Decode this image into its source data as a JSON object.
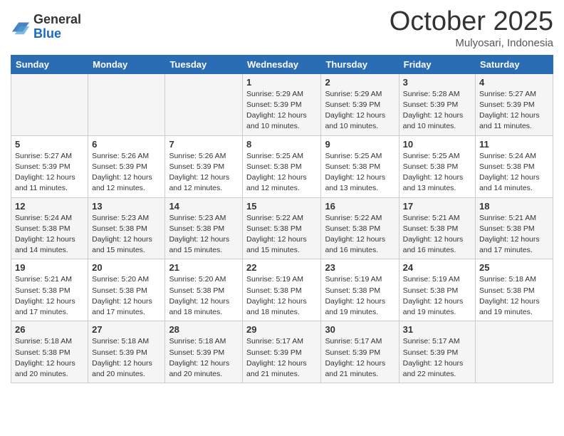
{
  "header": {
    "logo_general": "General",
    "logo_blue": "Blue",
    "month_title": "October 2025",
    "subtitle": "Mulyosari, Indonesia"
  },
  "weekdays": [
    "Sunday",
    "Monday",
    "Tuesday",
    "Wednesday",
    "Thursday",
    "Friday",
    "Saturday"
  ],
  "weeks": [
    [
      {
        "day": "",
        "sunrise": "",
        "sunset": "",
        "daylight": ""
      },
      {
        "day": "",
        "sunrise": "",
        "sunset": "",
        "daylight": ""
      },
      {
        "day": "",
        "sunrise": "",
        "sunset": "",
        "daylight": ""
      },
      {
        "day": "1",
        "sunrise": "Sunrise: 5:29 AM",
        "sunset": "Sunset: 5:39 PM",
        "daylight": "Daylight: 12 hours and 10 minutes."
      },
      {
        "day": "2",
        "sunrise": "Sunrise: 5:29 AM",
        "sunset": "Sunset: 5:39 PM",
        "daylight": "Daylight: 12 hours and 10 minutes."
      },
      {
        "day": "3",
        "sunrise": "Sunrise: 5:28 AM",
        "sunset": "Sunset: 5:39 PM",
        "daylight": "Daylight: 12 hours and 10 minutes."
      },
      {
        "day": "4",
        "sunrise": "Sunrise: 5:27 AM",
        "sunset": "Sunset: 5:39 PM",
        "daylight": "Daylight: 12 hours and 11 minutes."
      }
    ],
    [
      {
        "day": "5",
        "sunrise": "Sunrise: 5:27 AM",
        "sunset": "Sunset: 5:39 PM",
        "daylight": "Daylight: 12 hours and 11 minutes."
      },
      {
        "day": "6",
        "sunrise": "Sunrise: 5:26 AM",
        "sunset": "Sunset: 5:39 PM",
        "daylight": "Daylight: 12 hours and 12 minutes."
      },
      {
        "day": "7",
        "sunrise": "Sunrise: 5:26 AM",
        "sunset": "Sunset: 5:39 PM",
        "daylight": "Daylight: 12 hours and 12 minutes."
      },
      {
        "day": "8",
        "sunrise": "Sunrise: 5:25 AM",
        "sunset": "Sunset: 5:38 PM",
        "daylight": "Daylight: 12 hours and 12 minutes."
      },
      {
        "day": "9",
        "sunrise": "Sunrise: 5:25 AM",
        "sunset": "Sunset: 5:38 PM",
        "daylight": "Daylight: 12 hours and 13 minutes."
      },
      {
        "day": "10",
        "sunrise": "Sunrise: 5:25 AM",
        "sunset": "Sunset: 5:38 PM",
        "daylight": "Daylight: 12 hours and 13 minutes."
      },
      {
        "day": "11",
        "sunrise": "Sunrise: 5:24 AM",
        "sunset": "Sunset: 5:38 PM",
        "daylight": "Daylight: 12 hours and 14 minutes."
      }
    ],
    [
      {
        "day": "12",
        "sunrise": "Sunrise: 5:24 AM",
        "sunset": "Sunset: 5:38 PM",
        "daylight": "Daylight: 12 hours and 14 minutes."
      },
      {
        "day": "13",
        "sunrise": "Sunrise: 5:23 AM",
        "sunset": "Sunset: 5:38 PM",
        "daylight": "Daylight: 12 hours and 15 minutes."
      },
      {
        "day": "14",
        "sunrise": "Sunrise: 5:23 AM",
        "sunset": "Sunset: 5:38 PM",
        "daylight": "Daylight: 12 hours and 15 minutes."
      },
      {
        "day": "15",
        "sunrise": "Sunrise: 5:22 AM",
        "sunset": "Sunset: 5:38 PM",
        "daylight": "Daylight: 12 hours and 15 minutes."
      },
      {
        "day": "16",
        "sunrise": "Sunrise: 5:22 AM",
        "sunset": "Sunset: 5:38 PM",
        "daylight": "Daylight: 12 hours and 16 minutes."
      },
      {
        "day": "17",
        "sunrise": "Sunrise: 5:21 AM",
        "sunset": "Sunset: 5:38 PM",
        "daylight": "Daylight: 12 hours and 16 minutes."
      },
      {
        "day": "18",
        "sunrise": "Sunrise: 5:21 AM",
        "sunset": "Sunset: 5:38 PM",
        "daylight": "Daylight: 12 hours and 17 minutes."
      }
    ],
    [
      {
        "day": "19",
        "sunrise": "Sunrise: 5:21 AM",
        "sunset": "Sunset: 5:38 PM",
        "daylight": "Daylight: 12 hours and 17 minutes."
      },
      {
        "day": "20",
        "sunrise": "Sunrise: 5:20 AM",
        "sunset": "Sunset: 5:38 PM",
        "daylight": "Daylight: 12 hours and 17 minutes."
      },
      {
        "day": "21",
        "sunrise": "Sunrise: 5:20 AM",
        "sunset": "Sunset: 5:38 PM",
        "daylight": "Daylight: 12 hours and 18 minutes."
      },
      {
        "day": "22",
        "sunrise": "Sunrise: 5:19 AM",
        "sunset": "Sunset: 5:38 PM",
        "daylight": "Daylight: 12 hours and 18 minutes."
      },
      {
        "day": "23",
        "sunrise": "Sunrise: 5:19 AM",
        "sunset": "Sunset: 5:38 PM",
        "daylight": "Daylight: 12 hours and 19 minutes."
      },
      {
        "day": "24",
        "sunrise": "Sunrise: 5:19 AM",
        "sunset": "Sunset: 5:38 PM",
        "daylight": "Daylight: 12 hours and 19 minutes."
      },
      {
        "day": "25",
        "sunrise": "Sunrise: 5:18 AM",
        "sunset": "Sunset: 5:38 PM",
        "daylight": "Daylight: 12 hours and 19 minutes."
      }
    ],
    [
      {
        "day": "26",
        "sunrise": "Sunrise: 5:18 AM",
        "sunset": "Sunset: 5:38 PM",
        "daylight": "Daylight: 12 hours and 20 minutes."
      },
      {
        "day": "27",
        "sunrise": "Sunrise: 5:18 AM",
        "sunset": "Sunset: 5:39 PM",
        "daylight": "Daylight: 12 hours and 20 minutes."
      },
      {
        "day": "28",
        "sunrise": "Sunrise: 5:18 AM",
        "sunset": "Sunset: 5:39 PM",
        "daylight": "Daylight: 12 hours and 20 minutes."
      },
      {
        "day": "29",
        "sunrise": "Sunrise: 5:17 AM",
        "sunset": "Sunset: 5:39 PM",
        "daylight": "Daylight: 12 hours and 21 minutes."
      },
      {
        "day": "30",
        "sunrise": "Sunrise: 5:17 AM",
        "sunset": "Sunset: 5:39 PM",
        "daylight": "Daylight: 12 hours and 21 minutes."
      },
      {
        "day": "31",
        "sunrise": "Sunrise: 5:17 AM",
        "sunset": "Sunset: 5:39 PM",
        "daylight": "Daylight: 12 hours and 22 minutes."
      },
      {
        "day": "",
        "sunrise": "",
        "sunset": "",
        "daylight": ""
      }
    ]
  ]
}
